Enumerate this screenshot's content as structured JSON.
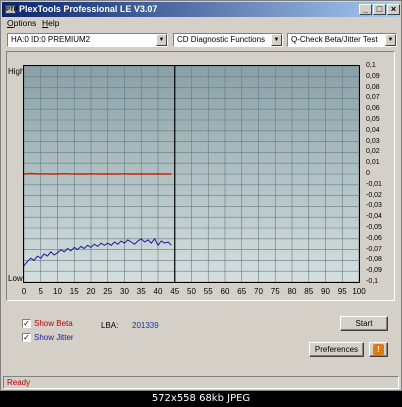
{
  "window": {
    "title": "PlexTools Professional LE V3.07",
    "icon_text": "PTP",
    "buttons": [
      "_",
      "□",
      "×"
    ]
  },
  "menu": [
    {
      "label": "Options",
      "underline": "O",
      "rest": "ptions"
    },
    {
      "label": "Help",
      "underline": "H",
      "rest": "elp"
    }
  ],
  "toolbar": {
    "drive": "HA:0 ID:0  PREMIUM2",
    "mode": "CD Diagnostic Functions",
    "test": "Q-Check Beta/Jitter Test"
  },
  "chart_data": {
    "type": "line",
    "y_left_labels": {
      "top": "High",
      "bottom": "Low"
    },
    "x_ticks": [
      "0",
      "5",
      "10",
      "15",
      "20",
      "25",
      "30",
      "35",
      "40",
      "45",
      "50",
      "55",
      "60",
      "65",
      "70",
      "75",
      "80",
      "85",
      "90",
      "95",
      "100"
    ],
    "y_right_ticks": [
      "0,1",
      "0,09",
      "0,08",
      "0,07",
      "0,06",
      "0,05",
      "0,04",
      "0,03",
      "0,02",
      "0,01",
      "0",
      "-0,01",
      "-0,02",
      "-0,03",
      "-0,04",
      "-0,05",
      "-0,06",
      "-0,07",
      "-0,08",
      "-0,09",
      "-0,1"
    ],
    "xlim": [
      0,
      100
    ],
    "ylim": [
      -0.1,
      0.1
    ],
    "progress_marker": 45,
    "colors": {
      "beta": "#cc2200",
      "jitter": "#1a1a9e",
      "marker": "#000000"
    },
    "series": [
      {
        "name": "Beta",
        "x": [
          0,
          2,
          4,
          6,
          8,
          10,
          12,
          14,
          16,
          18,
          20,
          22,
          24,
          26,
          28,
          30,
          32,
          34,
          36,
          38,
          40,
          42,
          44
        ],
        "y": [
          0.0,
          0.0005,
          0.0,
          0.0002,
          0.0,
          0.0,
          0.0003,
          0.0001,
          0.0,
          0.0,
          0.0002,
          0.0,
          0.0001,
          0.0,
          0.0,
          0.0002,
          0.0,
          0.0001,
          0.0,
          0.0,
          0.0001,
          0.0,
          0.0
        ]
      },
      {
        "name": "Jitter",
        "x": [
          0,
          1,
          2,
          3,
          4,
          5,
          6,
          7,
          8,
          9,
          10,
          11,
          12,
          13,
          14,
          15,
          16,
          17,
          18,
          19,
          20,
          21,
          22,
          23,
          24,
          25,
          26,
          27,
          28,
          29,
          30,
          31,
          32,
          33,
          34,
          35,
          36,
          37,
          38,
          39,
          40,
          41,
          42,
          43,
          44
        ],
        "y": [
          -0.085,
          -0.081,
          -0.078,
          -0.08,
          -0.076,
          -0.078,
          -0.074,
          -0.076,
          -0.072,
          -0.075,
          -0.073,
          -0.07,
          -0.072,
          -0.069,
          -0.071,
          -0.068,
          -0.07,
          -0.067,
          -0.069,
          -0.066,
          -0.068,
          -0.065,
          -0.067,
          -0.064,
          -0.066,
          -0.064,
          -0.066,
          -0.063,
          -0.065,
          -0.062,
          -0.064,
          -0.061,
          -0.063,
          -0.065,
          -0.062,
          -0.06,
          -0.063,
          -0.061,
          -0.064,
          -0.06,
          -0.066,
          -0.062,
          -0.064,
          -0.063,
          -0.066
        ]
      }
    ]
  },
  "controls": {
    "show_beta": {
      "label": "Show Beta",
      "checked": true
    },
    "show_jitter": {
      "label": "Show Jitter",
      "checked": true
    },
    "lba_label": "LBA:",
    "lba_value": "201339",
    "start_button": "Start",
    "preferences_button": "Preferences",
    "info_icon": "!"
  },
  "status": "Ready",
  "footer": "572x558 68kb JPEG"
}
